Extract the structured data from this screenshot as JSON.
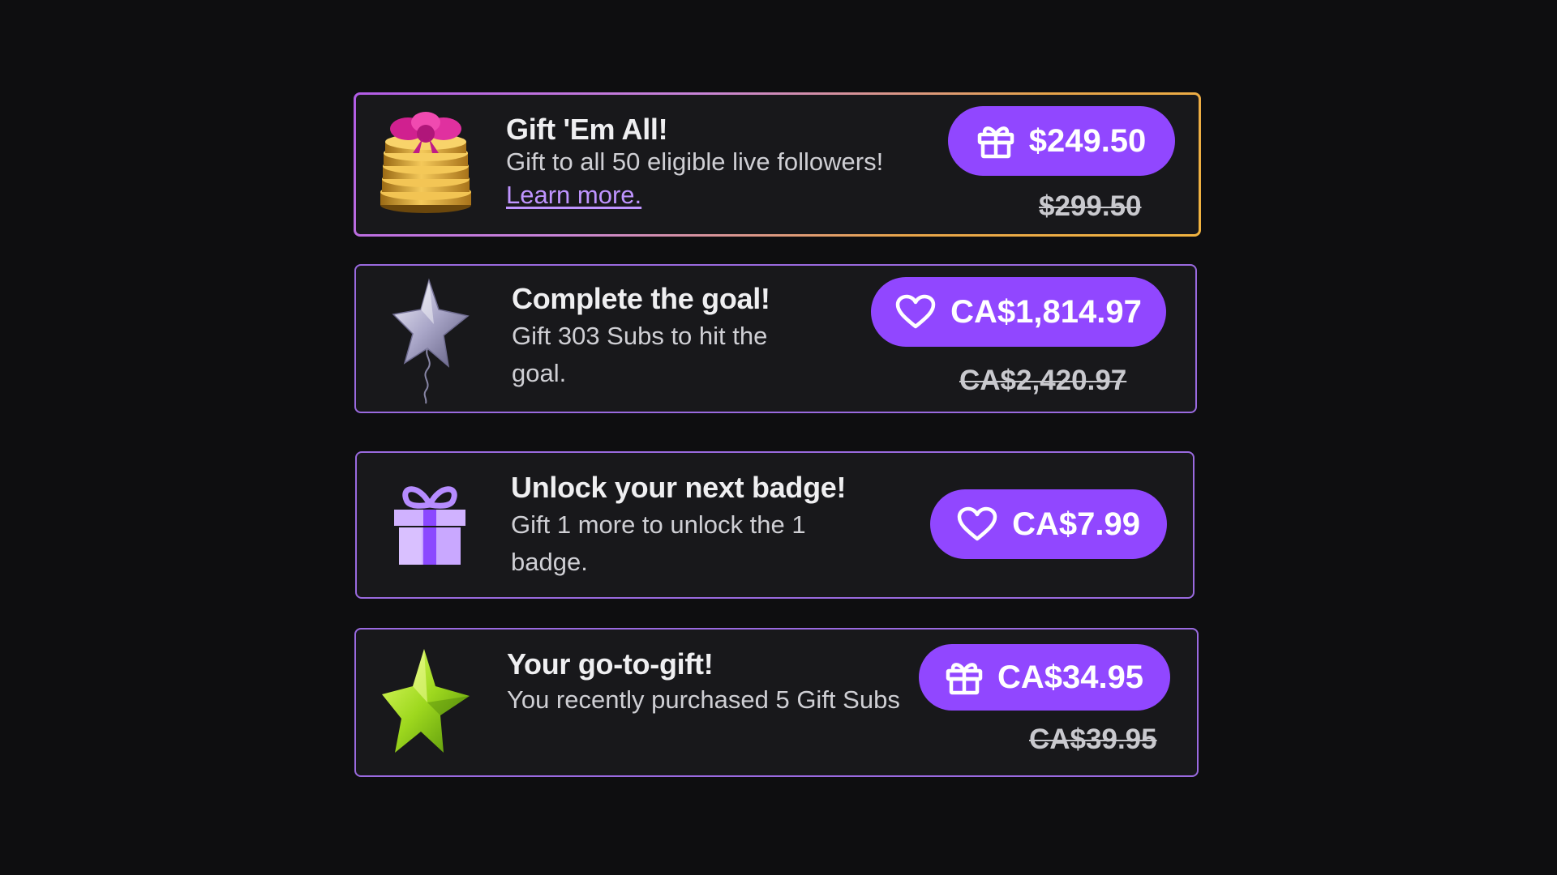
{
  "offers": [
    {
      "title": "Gift 'Em All!",
      "description": "Gift to all 50 eligible live followers!",
      "link": "Learn more.",
      "price": "$249.50",
      "old_price": "$299.50",
      "button_icon": "gift-icon",
      "image": "gold-coins-with-bow"
    },
    {
      "title": "Complete the goal!",
      "description": "Gift 303 Subs to hit the goal.",
      "price": "CA$1,814.97",
      "old_price": "CA$2,420.97",
      "button_icon": "heart-icon",
      "image": "silver-star-balloon"
    },
    {
      "title": "Unlock your next badge!",
      "description": "Gift 1 more to unlock the 1 badge.",
      "price": "CA$7.99",
      "button_icon": "heart-icon",
      "image": "purple-gift-box"
    },
    {
      "title": "Your go-to-gift!",
      "description": "You recently purchased 5 Gift Subs",
      "price": "CA$34.95",
      "old_price": "CA$39.95",
      "button_icon": "gift-icon",
      "image": "green-star"
    }
  ],
  "colors": {
    "accent": "#9147ff",
    "card_bg": "#18181b",
    "page_bg": "#0e0e10",
    "link": "#bf94ff"
  }
}
